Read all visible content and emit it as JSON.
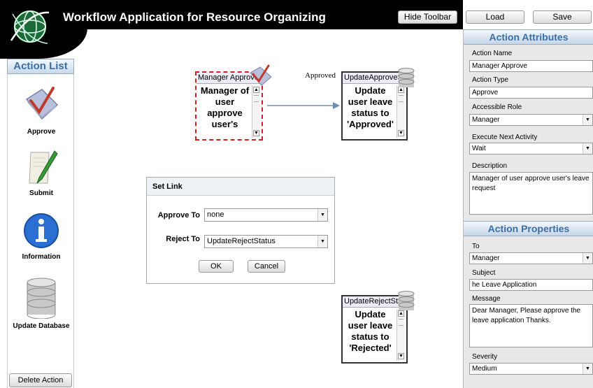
{
  "header": {
    "title": "Workflow Application for Resource Organizing",
    "hide_toolbar": "Hide Toolbar",
    "load": "Load",
    "save": "Save"
  },
  "action_list": {
    "title": "Action List",
    "items": [
      {
        "label": "Approve",
        "icon": "checkbox-approve-icon"
      },
      {
        "label": "Submit",
        "icon": "pen-paper-icon"
      },
      {
        "label": "Information",
        "icon": "information-icon"
      },
      {
        "label": "Update Database",
        "icon": "database-icon"
      }
    ],
    "delete_button": "Delete Action"
  },
  "canvas": {
    "nodes": [
      {
        "title": "Manager Approve",
        "body": "Manager of user approve user's",
        "icon": "checkbox-approve-icon",
        "selected": true
      },
      {
        "title": "UpdateApproveStatus",
        "body": "Update user leave status to 'Approved'",
        "icon": "database-icon"
      },
      {
        "title": "UpdateRejectStatus",
        "body": "Update user leave status to 'Rejected'",
        "icon": "database-icon"
      }
    ],
    "edge_label": "Approved"
  },
  "dialog": {
    "title": "Set Link",
    "approve_label": "Approve To",
    "approve_value": "none",
    "reject_label": "Reject To",
    "reject_value": "UpdateRejectStatus",
    "ok": "OK",
    "cancel": "Cancel"
  },
  "attributes": {
    "title": "Action Attributes",
    "name_label": "Action Name",
    "name_value": "Manager Approve",
    "type_label": "Action Type",
    "type_value": "Approve",
    "role_label": "Accessible Role",
    "role_value": "Manager",
    "next_label": "Execute Next Activity",
    "next_value": "Wait",
    "desc_label": "Description",
    "desc_value": "Manager of user approve user's leave request"
  },
  "properties": {
    "title": "Action Properties",
    "to_label": "To",
    "to_value": "Manager",
    "subject_label": "Subject",
    "subject_value": "he Leave Application",
    "message_label": "Message",
    "message_value": "Dear Manager, Please approve the leave application Thanks.",
    "severity_label": "Severity",
    "severity_value": "Medium"
  },
  "colors": {
    "accent": "#3a6ea5",
    "selected_border": "#cc2222",
    "arrow": "#6a8fb5"
  }
}
